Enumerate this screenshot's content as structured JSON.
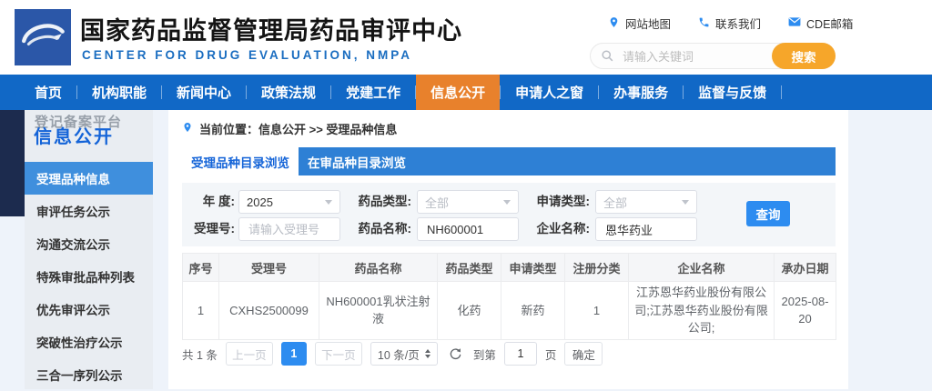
{
  "colors": {
    "nav_blue": "#1168c6",
    "nav_active_orange": "#e8812c",
    "search_button_orange": "#f6a62a",
    "tab_bar_blue": "#2e80d5",
    "primary_button_blue": "#2d8cf0",
    "sidebar_active_blue": "#3f8fdd",
    "logo_blue": "#2b57a8",
    "subtitle_blue": "#1a6dc0"
  },
  "header": {
    "title": "国家药品监督管理局药品审评中心",
    "subtitle": "CENTER FOR DRUG EVALUATION, NMPA",
    "links": [
      {
        "icon": "location-pin-icon",
        "label": "网站地图"
      },
      {
        "icon": "phone-icon",
        "label": "联系我们"
      },
      {
        "icon": "envelope-icon",
        "label": "CDE邮箱"
      }
    ],
    "search": {
      "placeholder": "请输入关键词",
      "button": "搜索"
    }
  },
  "nav": {
    "items": [
      {
        "label": "首页",
        "active": false
      },
      {
        "label": "机构职能",
        "active": false
      },
      {
        "label": "新闻中心",
        "active": false
      },
      {
        "label": "政策法规",
        "active": false
      },
      {
        "label": "党建工作",
        "active": false
      },
      {
        "label": "信息公开",
        "active": true
      },
      {
        "label": "申请人之窗",
        "active": false
      },
      {
        "label": "办事服务",
        "active": false
      },
      {
        "label": "监督与反馈",
        "active": false
      }
    ]
  },
  "sidebar": {
    "watermark": "登记备案平台",
    "title": "信息公开",
    "items": [
      {
        "label": "受理品种信息",
        "active": true
      },
      {
        "label": "审评任务公示",
        "active": false
      },
      {
        "label": "沟通交流公示",
        "active": false
      },
      {
        "label": "特殊审批品种列表",
        "active": false
      },
      {
        "label": "优先审评公示",
        "active": false
      },
      {
        "label": "突破性治疗公示",
        "active": false
      },
      {
        "label": "三合一序列公示",
        "active": false
      }
    ]
  },
  "breadcrumb": {
    "label": "当前位置：信息公开 >> 受理品种信息"
  },
  "tabs": [
    {
      "label": "受理品种目录浏览",
      "active": true
    },
    {
      "label": "在审品种目录浏览",
      "active": false
    }
  ],
  "form": {
    "fields": [
      {
        "label": "年 度:",
        "type": "select",
        "value": "2025"
      },
      {
        "label": "药品类型:",
        "type": "select",
        "value": "全部"
      },
      {
        "label": "申请类型:",
        "type": "select",
        "value": "全部"
      },
      {
        "label": "受理号:",
        "type": "input",
        "placeholder": "请输入受理号",
        "value": ""
      },
      {
        "label": "药品名称:",
        "type": "input",
        "value": "NH600001"
      },
      {
        "label": "企业名称:",
        "type": "input",
        "value": "恩华药业"
      }
    ],
    "submit_label": "查询"
  },
  "table": {
    "columns": [
      "序号",
      "受理号",
      "药品名称",
      "药品类型",
      "申请类型",
      "注册分类",
      "企业名称",
      "承办日期"
    ],
    "rows": [
      [
        "1",
        "CXHS2500099",
        "NH600001乳状注射液",
        "化药",
        "新药",
        "1",
        "江苏恩华药业股份有限公司;江苏恩华药业股份有限公司;",
        "2025-08-20"
      ]
    ]
  },
  "pagination": {
    "total": "共 1 条",
    "prev": "上一页",
    "page": "1",
    "next": "下一页",
    "page_size": "10 条/页",
    "goto_label": "到第",
    "goto_value": "1",
    "goto_unit": "页",
    "confirm": "确定"
  }
}
